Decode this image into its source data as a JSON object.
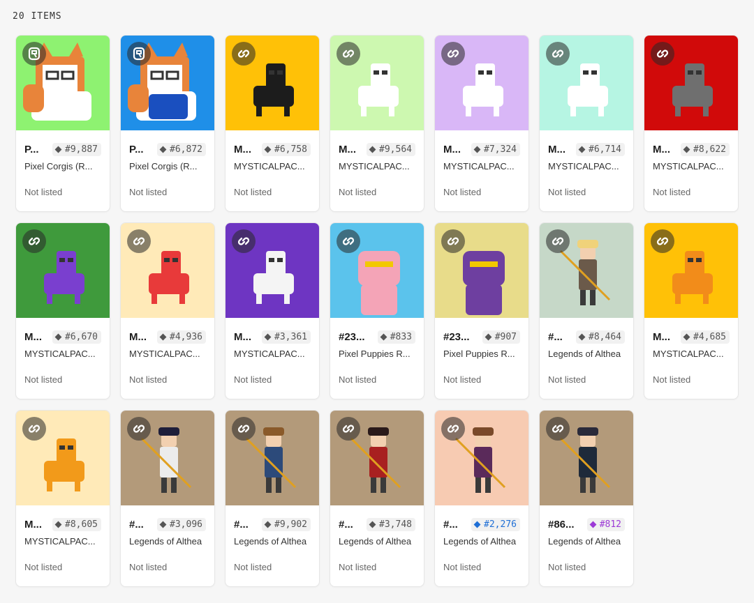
{
  "header": {
    "items_count": "20 ITEMS"
  },
  "items": [
    {
      "name": "P...",
      "token": "#9,887",
      "collection": "Pixel Corgis (R...",
      "status": "Not listed",
      "bg": "#8ef271",
      "art": "corgi",
      "chain": "r-icon",
      "variant": "grey"
    },
    {
      "name": "P...",
      "token": "#6,872",
      "collection": "Pixel Corgis (R...",
      "status": "Not listed",
      "bg": "#1f8fe8",
      "art": "corgi-blue",
      "chain": "r-icon",
      "variant": "grey"
    },
    {
      "name": "M...",
      "token": "#6,758",
      "collection": "MYSTICALPAC...",
      "status": "Not listed",
      "bg": "#ffc107",
      "art": "alpaca-black",
      "chain": "link-icon",
      "variant": "grey"
    },
    {
      "name": "M...",
      "token": "#9,564",
      "collection": "MYSTICALPAC...",
      "status": "Not listed",
      "bg": "#cdf8b0",
      "art": "alpaca-white",
      "chain": "link-icon",
      "variant": "grey"
    },
    {
      "name": "M...",
      "token": "#7,324",
      "collection": "MYSTICALPAC...",
      "status": "Not listed",
      "bg": "#d9b7f7",
      "art": "alpaca-cow",
      "chain": "link-icon",
      "variant": "grey"
    },
    {
      "name": "M...",
      "token": "#6,714",
      "collection": "MYSTICALPAC...",
      "status": "Not listed",
      "bg": "#b6f5e3",
      "art": "alpaca-spots",
      "chain": "link-icon",
      "variant": "grey"
    },
    {
      "name": "M...",
      "token": "#8,622",
      "collection": "MYSTICALPAC...",
      "status": "Not listed",
      "bg": "#d10a0a",
      "art": "alpaca-grey",
      "chain": "link-icon",
      "variant": "grey"
    },
    {
      "name": "M...",
      "token": "#6,670",
      "collection": "MYSTICALPAC...",
      "status": "Not listed",
      "bg": "#3f9a3c",
      "art": "alpaca-purple",
      "chain": "link-icon",
      "variant": "grey"
    },
    {
      "name": "M...",
      "token": "#4,936",
      "collection": "MYSTICALPAC...",
      "status": "Not listed",
      "bg": "#ffeab8",
      "art": "alpaca-red",
      "chain": "link-icon",
      "variant": "grey"
    },
    {
      "name": "M...",
      "token": "#3,361",
      "collection": "MYSTICALPAC...",
      "status": "Not listed",
      "bg": "#6e35c2",
      "art": "alpaca-ghost",
      "chain": "link-icon",
      "variant": "grey"
    },
    {
      "name": "#23...",
      "token": "#833",
      "collection": "Pixel Puppies R...",
      "status": "Not listed",
      "bg": "#5bc3ec",
      "art": "puppy-pink",
      "chain": "link-icon",
      "variant": "grey"
    },
    {
      "name": "#23...",
      "token": "#907",
      "collection": "Pixel Puppies R...",
      "status": "Not listed",
      "bg": "#e8dc8a",
      "art": "puppy-purple",
      "chain": "link-icon",
      "variant": "grey"
    },
    {
      "name": "#...",
      "token": "#8,464",
      "collection": "Legends of Althea",
      "status": "Not listed",
      "bg": "#c6d8c8",
      "art": "althea-blonde",
      "chain": "link-icon",
      "variant": "grey"
    },
    {
      "name": "M...",
      "token": "#4,685",
      "collection": "MYSTICALPAC...",
      "status": "Not listed",
      "bg": "#ffc107",
      "art": "alpaca-mummy",
      "chain": "link-icon",
      "variant": "grey"
    },
    {
      "name": "M...",
      "token": "#8,605",
      "collection": "MYSTICALPAC...",
      "status": "Not listed",
      "bg": "#ffeab8",
      "art": "alpaca-orange",
      "chain": "link-icon",
      "variant": "grey"
    },
    {
      "name": "#...",
      "token": "#3,096",
      "collection": "Legends of Althea",
      "status": "Not listed",
      "bg": "#b39a7a",
      "art": "althea-tiger",
      "chain": "link-icon",
      "variant": "grey"
    },
    {
      "name": "#...",
      "token": "#9,902",
      "collection": "Legends of Althea",
      "status": "Not listed",
      "bg": "#b39a7a",
      "art": "althea-archer",
      "chain": "link-icon",
      "variant": "grey"
    },
    {
      "name": "#...",
      "token": "#3,748",
      "collection": "Legends of Althea",
      "status": "Not listed",
      "bg": "#b39a7a",
      "art": "althea-red",
      "chain": "link-icon",
      "variant": "grey"
    },
    {
      "name": "#...",
      "token": "#2,276",
      "collection": "Legends of Althea",
      "status": "Not listed",
      "bg": "#f7cbb2",
      "art": "althea-fire",
      "chain": "link-icon",
      "variant": "blue"
    },
    {
      "name": "#86...",
      "token": "#812",
      "collection": "Legends of Althea",
      "status": "Not listed",
      "bg": "#b39a7a",
      "art": "althea-dark",
      "chain": "link-icon",
      "variant": "purple"
    }
  ]
}
